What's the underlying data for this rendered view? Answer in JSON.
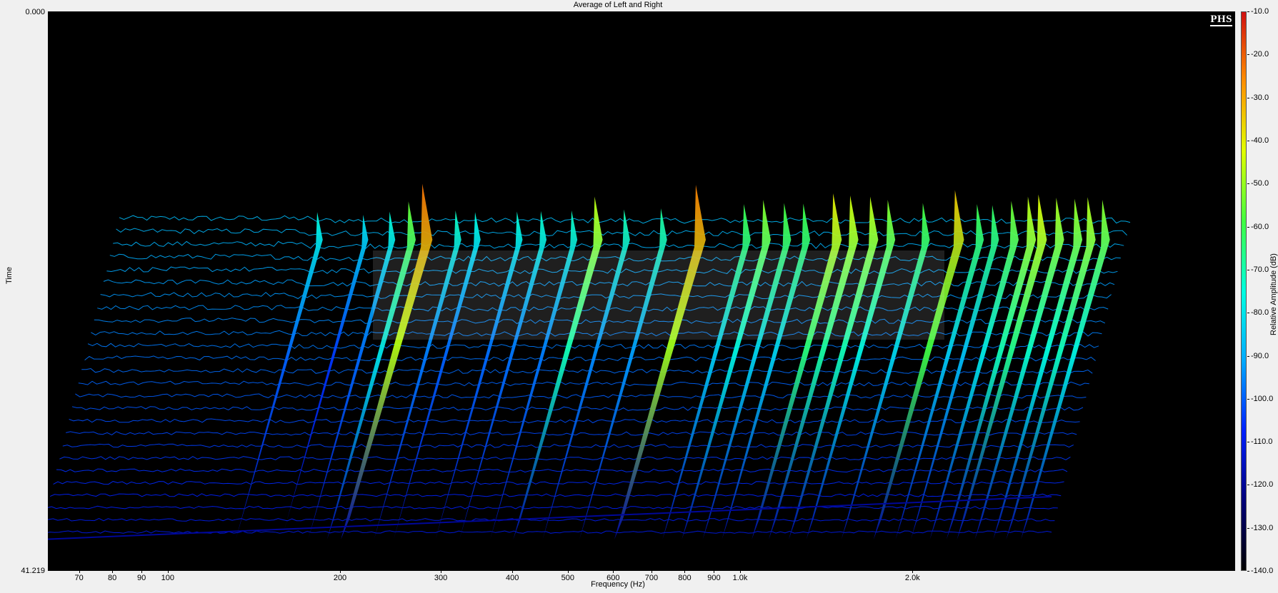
{
  "chart_data": {
    "type": "waterfall",
    "title": "Average of Left and Right",
    "xlabel": "Frequency (Hz)",
    "ylabel": "Time",
    "zlabel": "Relative Amplitude (dB)",
    "x_scale": "log",
    "xlim": [
      60,
      3500
    ],
    "ylim": [
      0.0,
      41.219
    ],
    "y_tick_labels": [
      "0.000",
      "41.219"
    ],
    "x_ticks": [
      {
        "value": 70,
        "label": "70"
      },
      {
        "value": 80,
        "label": "80"
      },
      {
        "value": 90,
        "label": "90"
      },
      {
        "value": 100,
        "label": "100"
      },
      {
        "value": 200,
        "label": "200"
      },
      {
        "value": 300,
        "label": "300"
      },
      {
        "value": 400,
        "label": "400"
      },
      {
        "value": 500,
        "label": "500"
      },
      {
        "value": 600,
        "label": "600"
      },
      {
        "value": 700,
        "label": "700"
      },
      {
        "value": 800,
        "label": "800"
      },
      {
        "value": 900,
        "label": "900"
      },
      {
        "value": 1000,
        "label": "1.0k"
      },
      {
        "value": 2000,
        "label": "2.0k"
      }
    ],
    "colorbar": {
      "range": [
        -140,
        -10
      ],
      "ticks": [
        "-10.0",
        "-20.0",
        "-30.0",
        "-40.0",
        "-50.0",
        "-60.0",
        "-70.0",
        "-80.0",
        "-90.0",
        "-100.0",
        "-110.0",
        "-120.0",
        "-130.0",
        "-140.0"
      ],
      "colors": [
        "#000000",
        "#00007a",
        "#0020ff",
        "#00aaff",
        "#00ffe0",
        "#40ff40",
        "#e0ff00",
        "#ff9000",
        "#d01010"
      ]
    },
    "peaks": [
      {
        "freq": 133,
        "db": -75
      },
      {
        "freq": 160,
        "db": -80
      },
      {
        "freq": 178,
        "db": -74
      },
      {
        "freq": 192,
        "db": -55
      },
      {
        "freq": 203,
        "db": -22
      },
      {
        "freq": 232,
        "db": -72
      },
      {
        "freq": 251,
        "db": -75
      },
      {
        "freq": 297,
        "db": -74
      },
      {
        "freq": 327,
        "db": -73
      },
      {
        "freq": 370,
        "db": -72
      },
      {
        "freq": 406,
        "db": -46
      },
      {
        "freq": 457,
        "db": -70
      },
      {
        "freq": 530,
        "db": -68
      },
      {
        "freq": 610,
        "db": -24
      },
      {
        "freq": 740,
        "db": -60
      },
      {
        "freq": 800,
        "db": -52
      },
      {
        "freq": 870,
        "db": -58
      },
      {
        "freq": 940,
        "db": -59
      },
      {
        "freq": 1060,
        "db": -40
      },
      {
        "freq": 1135,
        "db": -44
      },
      {
        "freq": 1230,
        "db": -46
      },
      {
        "freq": 1320,
        "db": -52
      },
      {
        "freq": 1520,
        "db": -58
      },
      {
        "freq": 1730,
        "db": -34
      },
      {
        "freq": 1890,
        "db": -60
      },
      {
        "freq": 2010,
        "db": -62
      },
      {
        "freq": 2170,
        "db": -54
      },
      {
        "freq": 2320,
        "db": -46
      },
      {
        "freq": 2420,
        "db": -42
      },
      {
        "freq": 2600,
        "db": -48
      },
      {
        "freq": 2800,
        "db": -50
      },
      {
        "freq": 2950,
        "db": -47
      },
      {
        "freq": 3130,
        "db": -52
      }
    ]
  },
  "brand": "PHS"
}
